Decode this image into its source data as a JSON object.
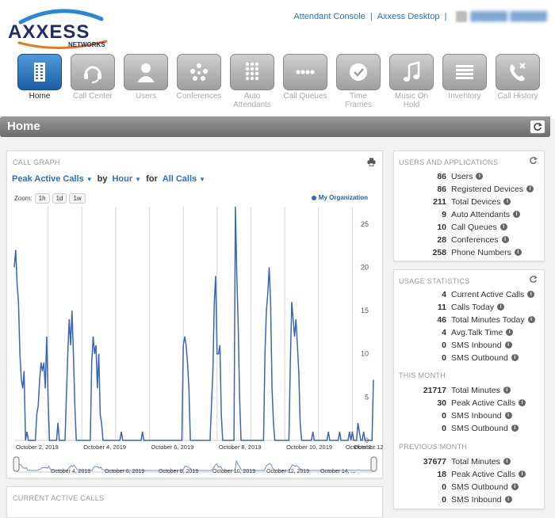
{
  "header": {
    "logo_main": "AXXESS",
    "logo_sub": "NETWORKS",
    "links": [
      "Attendant Console",
      "Axxess Desktop"
    ]
  },
  "nav": [
    {
      "label": "Home",
      "icon": "building-icon",
      "active": true
    },
    {
      "label": "Call Center",
      "icon": "headset-icon"
    },
    {
      "label": "Users",
      "icon": "user-icon"
    },
    {
      "label": "Conferences",
      "icon": "conference-dots-icon"
    },
    {
      "label": "Auto Attendants",
      "icon": "keypad-icon"
    },
    {
      "label": "Call Queues",
      "icon": "queue-dots-icon"
    },
    {
      "label": "Time Frames",
      "icon": "clock-icon"
    },
    {
      "label": "Music On Hold",
      "icon": "music-note-icon"
    },
    {
      "label": "Inventory",
      "icon": "list-icon"
    },
    {
      "label": "Call History",
      "icon": "phone-history-icon"
    }
  ],
  "page": {
    "title": "Home"
  },
  "call_graph": {
    "title": "CALL GRAPH",
    "metric": "Peak Active Calls",
    "by_word": "by",
    "interval": "Hour",
    "for_word": "for",
    "scope": "All Calls",
    "zoom_label": "Zoom:",
    "zoom_options": [
      "1h",
      "1d",
      "1w"
    ],
    "legend": "My Organization",
    "navigator_labels": [
      "October 4, 2019",
      "October 6, 2019",
      "October 8, 2019",
      "October 10, 2019",
      "October 12, 2019",
      "October 14, ..."
    ]
  },
  "chart_data": {
    "type": "line",
    "series": [
      {
        "name": "My Organization",
        "color": "#3a66b5"
      }
    ],
    "x_tick_labels": [
      "October 2, 2019",
      "October 4, 2019",
      "October 6, 2019",
      "October 8, 2019",
      "October 10, 2019",
      "October 12, 2019",
      "October 1..."
    ],
    "y_ticks": [
      0,
      5,
      10,
      15,
      20,
      25
    ],
    "ylim": [
      0,
      27
    ],
    "grid": "vertical",
    "legend_position": "top-right",
    "hourly_values": [
      20,
      22,
      18,
      16,
      10,
      7,
      6,
      8,
      0,
      1,
      0,
      0,
      0,
      0,
      0,
      0,
      3,
      4,
      7,
      9,
      8,
      9,
      6,
      12,
      5,
      0,
      0,
      0,
      0,
      0,
      0,
      2,
      0,
      0,
      0,
      0,
      0,
      5,
      10,
      14,
      11,
      15,
      10,
      4,
      0,
      0,
      0,
      0,
      0,
      0,
      0,
      0,
      0,
      0,
      0,
      9,
      12,
      10,
      11,
      6,
      10,
      3,
      2,
      0,
      0,
      0,
      0,
      0,
      0,
      0,
      0,
      0,
      0,
      0,
      0,
      0,
      1,
      0,
      0,
      0,
      0,
      0,
      0,
      0,
      0,
      0,
      0,
      0,
      0,
      0,
      0,
      1,
      0,
      0,
      0,
      0,
      0,
      0,
      0,
      0,
      0,
      0,
      0,
      0,
      0,
      0,
      0,
      0,
      0,
      0,
      0,
      0,
      0,
      0,
      0,
      0,
      0,
      0,
      0,
      0,
      11,
      12,
      11,
      9,
      6,
      0,
      0,
      0,
      0,
      0,
      0,
      0,
      0,
      0,
      0,
      0,
      0,
      0,
      0,
      0,
      4,
      8,
      16,
      19,
      10,
      10,
      11,
      3,
      0,
      0,
      0,
      0,
      0,
      0,
      0,
      0,
      0,
      27,
      19,
      13,
      5,
      0,
      0,
      0,
      0,
      0,
      0,
      0,
      0,
      0,
      0,
      0,
      0,
      0,
      0,
      0,
      0,
      0,
      10,
      15,
      17,
      20,
      16,
      6,
      2,
      0,
      0,
      0,
      0,
      0,
      0,
      0,
      0,
      0,
      0,
      0,
      9,
      16,
      14,
      12,
      14,
      11,
      8,
      2,
      0,
      0,
      0,
      0,
      0,
      0,
      0,
      0,
      1,
      0,
      0,
      0,
      0,
      0,
      0,
      0,
      0,
      0,
      0,
      1,
      0,
      0,
      0,
      0,
      0,
      0,
      0,
      1,
      0,
      0,
      0,
      0,
      0,
      0,
      1,
      0,
      1,
      0,
      0,
      0,
      2,
      1,
      0,
      0,
      1,
      0,
      0,
      0,
      0,
      0,
      0,
      7
    ]
  },
  "current_active_calls": {
    "title": "CURRENT ACTIVE CALLS"
  },
  "users_apps": {
    "title": "USERS AND APPLICATIONS",
    "rows": [
      {
        "value": "86",
        "label": "Users"
      },
      {
        "value": "86",
        "label": "Registered Devices"
      },
      {
        "value": "211",
        "label": "Total Devices"
      },
      {
        "value": "9",
        "label": "Auto Attendants"
      },
      {
        "value": "10",
        "label": "Call Queues"
      },
      {
        "value": "28",
        "label": "Conferences"
      },
      {
        "value": "258",
        "label": "Phone Numbers"
      }
    ]
  },
  "usage": {
    "title": "USAGE STATISTICS",
    "rows": [
      {
        "value": "4",
        "label": "Current Active Calls"
      },
      {
        "value": "11",
        "label": "Calls Today"
      },
      {
        "value": "46",
        "label": "Total Minutes Today"
      },
      {
        "value": "4",
        "label": "Avg.Talk Time"
      },
      {
        "value": "0",
        "label": "SMS Inbound"
      },
      {
        "value": "0",
        "label": "SMS Outbound"
      }
    ],
    "this_month_title": "THIS MONTH",
    "this_month": [
      {
        "value": "21717",
        "label": "Total Minutes"
      },
      {
        "value": "30",
        "label": "Peak Active Calls"
      },
      {
        "value": "0",
        "label": "SMS Inbound"
      },
      {
        "value": "0",
        "label": "SMS Outbound"
      }
    ],
    "prev_month_title": "PREVIOUS MONTH",
    "prev_month": [
      {
        "value": "37677",
        "label": "Total Minutes"
      },
      {
        "value": "18",
        "label": "Peak Active Calls"
      },
      {
        "value": "0",
        "label": "SMS Outbound"
      },
      {
        "value": "0",
        "label": "SMS Inbound"
      }
    ]
  }
}
